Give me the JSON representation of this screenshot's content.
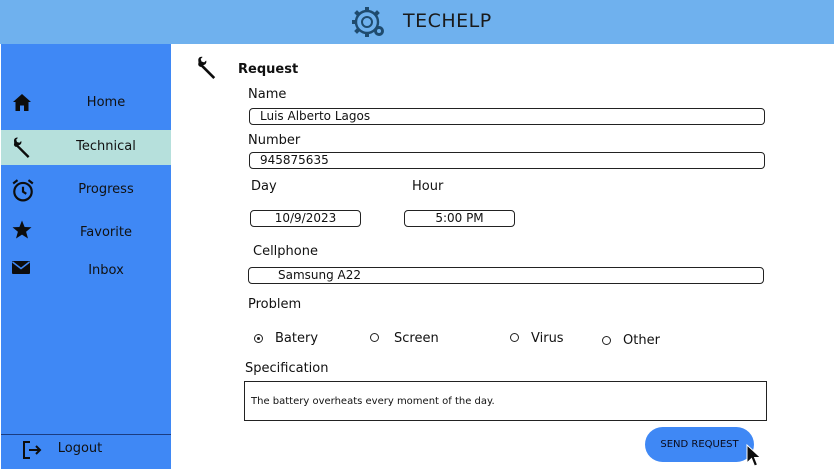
{
  "header": {
    "app_title": "TECHELP",
    "logo_icon": "gear-wrench-logo-icon"
  },
  "sidebar": {
    "items": [
      {
        "label": "Home",
        "icon": "home-icon",
        "active": false
      },
      {
        "label": "Technical",
        "icon": "wrench-icon",
        "active": true
      },
      {
        "label": "Progress",
        "icon": "alarm-clock-icon",
        "active": false
      },
      {
        "label": "Favorite",
        "icon": "star-icon",
        "active": false
      },
      {
        "label": "Inbox",
        "icon": "envelope-icon",
        "active": false
      }
    ],
    "logout_label": "Logout"
  },
  "form": {
    "title": "Request",
    "name_label": "Name",
    "name_value": "Luis Alberto Lagos",
    "number_label": "Number",
    "number_value": "945875635",
    "day_label": "Day",
    "day_value": "10/9/2023",
    "hour_label": "Hour",
    "hour_value": "5:00 PM",
    "cellphone_label": "Cellphone",
    "cellphone_value": "Samsung A22",
    "problem_label": "Problem",
    "problem_options": [
      {
        "label": "Batery",
        "checked": true
      },
      {
        "label": "Screen",
        "checked": false
      },
      {
        "label": "Virus",
        "checked": false
      },
      {
        "label": "Other",
        "checked": false
      }
    ],
    "specification_label": "Specification",
    "specification_value": "The battery overheats every moment of the day.",
    "send_label": "SEND REQUEST"
  },
  "colors": {
    "header_bg": "#6fb1ee",
    "sidebar_bg": "#3f88f5",
    "active_item_bg": "#b6e0dc",
    "button_bg": "#3f88f5"
  }
}
